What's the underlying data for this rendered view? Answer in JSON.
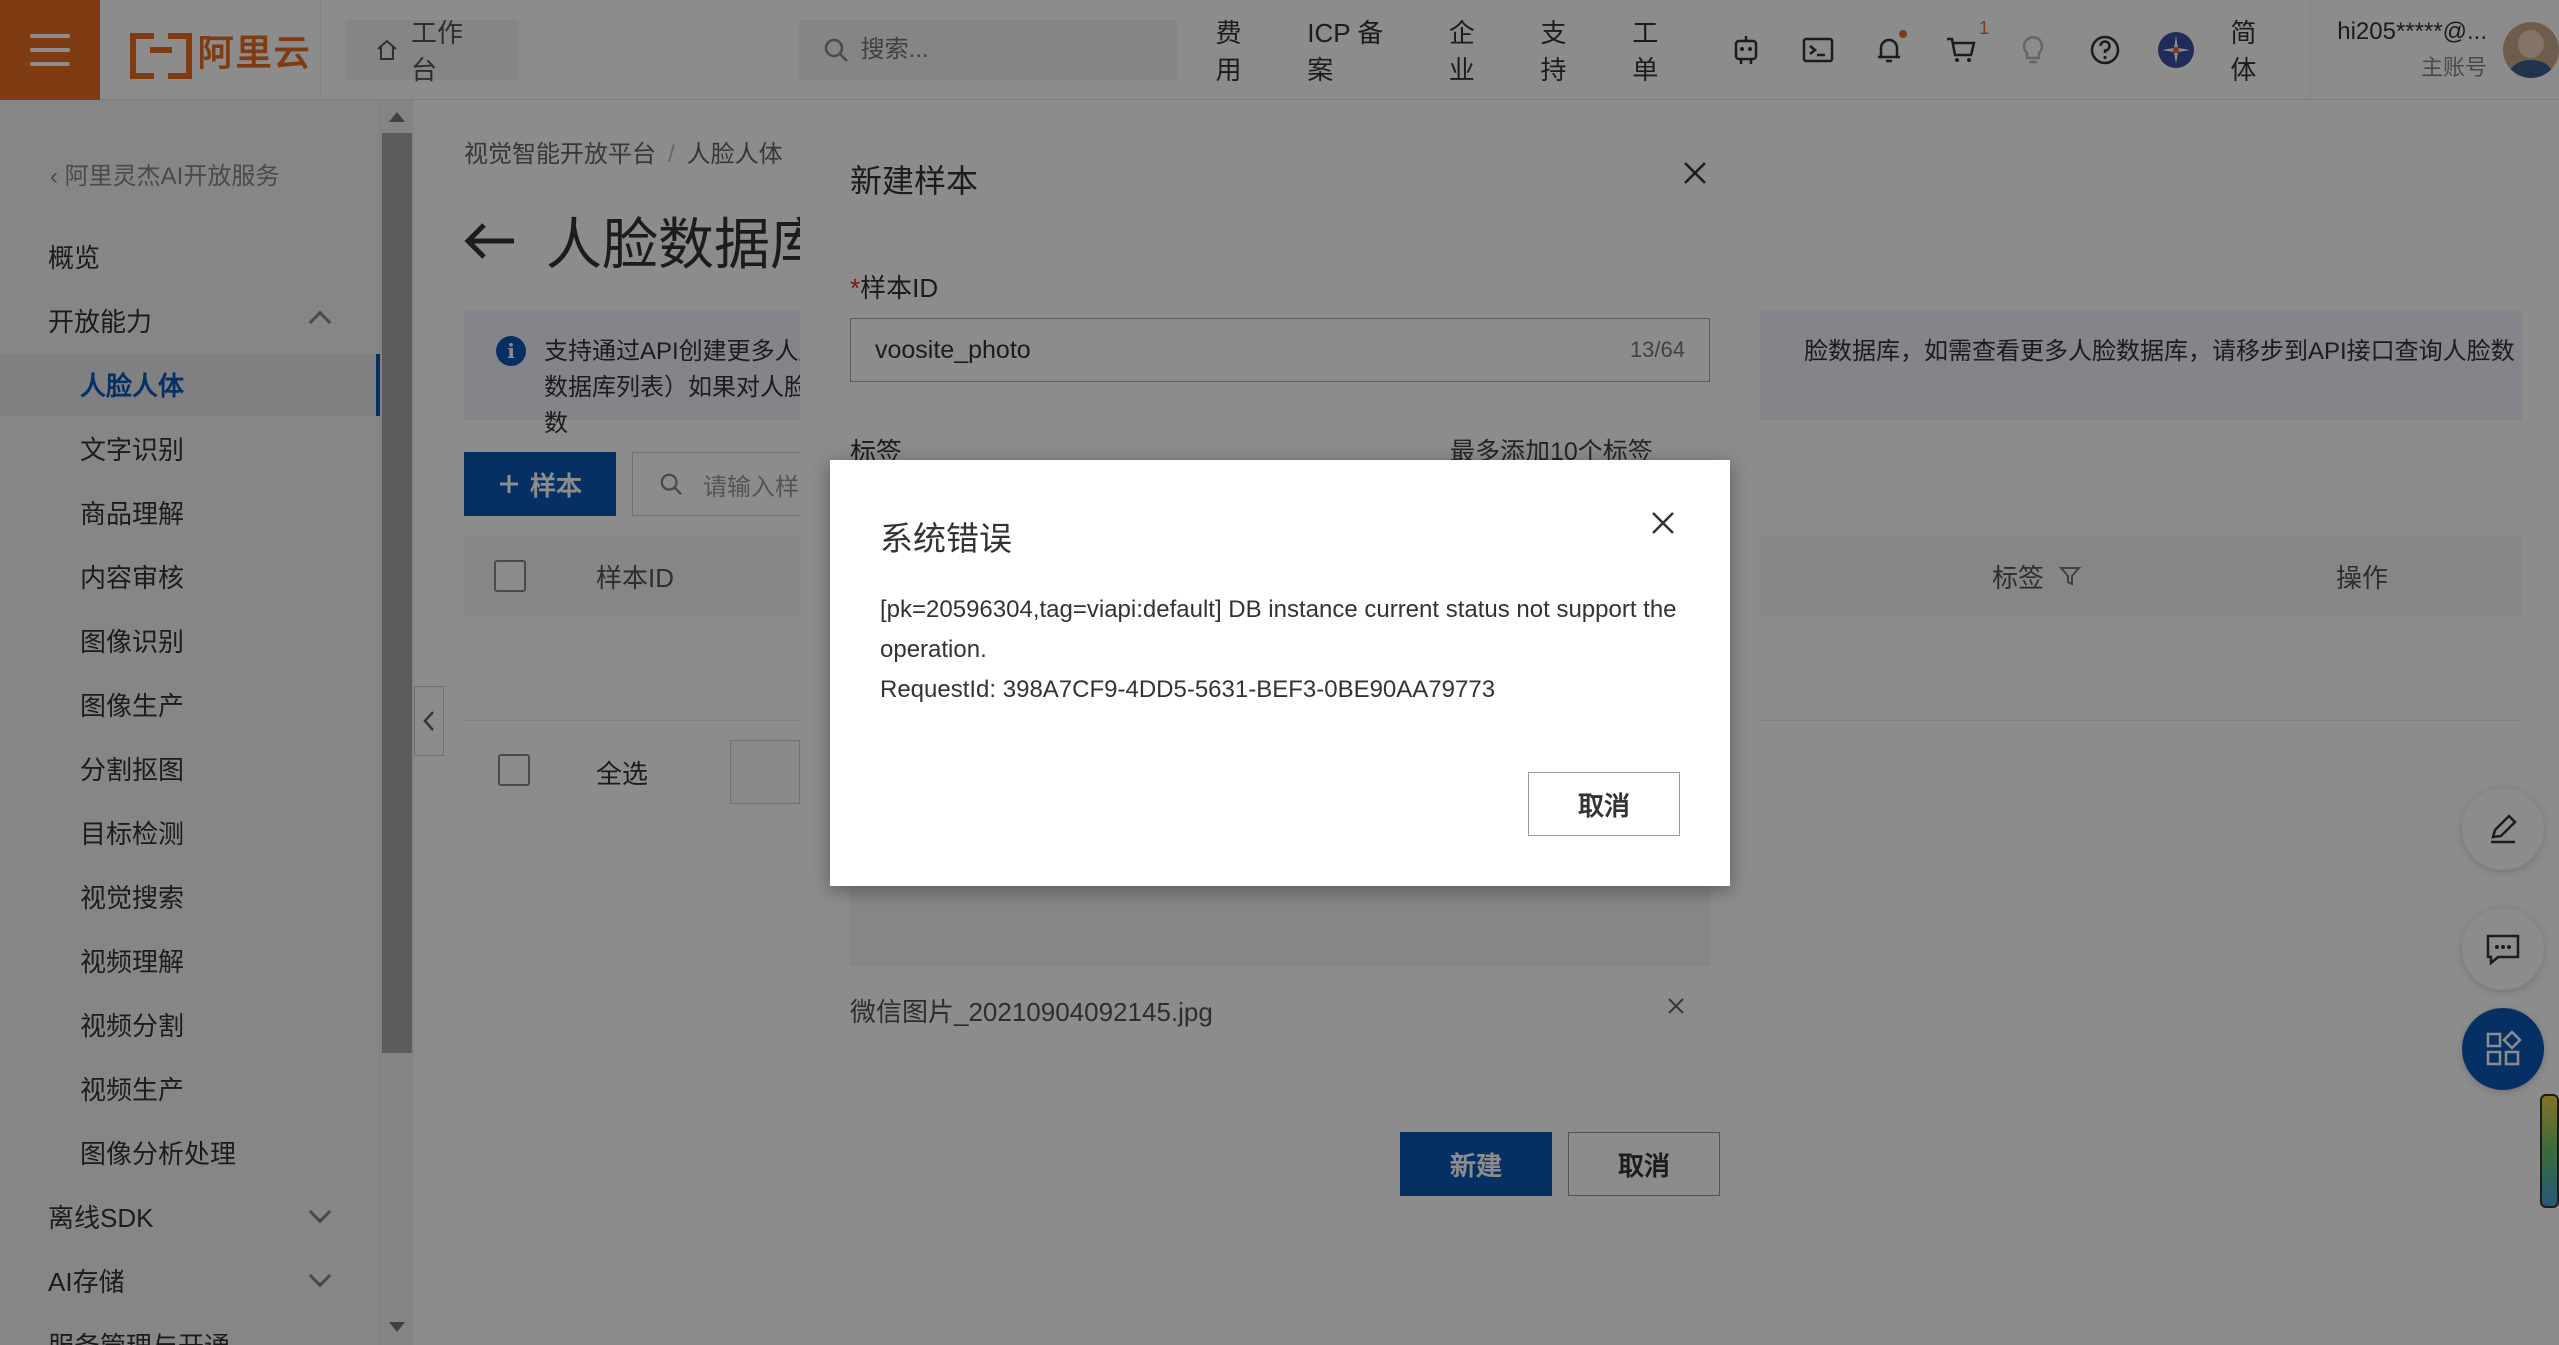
{
  "topbar": {
    "logo_text": "阿里云",
    "workbench": "工作台",
    "search_placeholder": "搜索...",
    "links": [
      "费用",
      "ICP 备案",
      "企业",
      "支持",
      "工单"
    ],
    "cart_count": "1",
    "language": "简体",
    "user_name": "hi205*****@...",
    "user_role": "主账号"
  },
  "sidebar": {
    "back_label": "阿里灵杰AI开放服务",
    "overview": "概览",
    "group_open": "开放能力",
    "items": [
      "人脸人体",
      "文字识别",
      "商品理解",
      "内容审核",
      "图像识别",
      "图像生产",
      "分割抠图",
      "目标检测",
      "视觉搜索",
      "视频理解",
      "视频分割",
      "视频生产",
      "图像分析处理"
    ],
    "group_sdk": "离线SDK",
    "group_storage": "AI存储",
    "group_service": "服务管理与开通"
  },
  "main": {
    "breadcrumb": [
      "视觉智能开放平台",
      "人脸人体"
    ],
    "title": "人脸数据库",
    "info_left": "支持通过API创建更多人脸数据库列表）如果对人脸数",
    "info_right": "脸数据库，如需查看更多人脸数据库，请移步到API接口查询人脸数",
    "add_button": "样本",
    "filter_placeholder": "请输入样",
    "columns": {
      "sample_id": "样本ID",
      "tags": "标签",
      "actions": "操作"
    },
    "select_all": "全选"
  },
  "new_sample_dialog": {
    "title": "新建样本",
    "sample_id_label": "样本ID",
    "sample_id_value": "voosite_photo",
    "sample_id_counter": "13/64",
    "tags_label": "标签",
    "tags_hint": "最多添加10个标签",
    "file_name": "微信图片_20210904092145.jpg",
    "create_button": "新建",
    "cancel_button": "取消"
  },
  "error_dialog": {
    "title": "系统错误",
    "message": "[pk=20596304,tag=viapi:default] DB instance current status not support the operation.",
    "request_id": "RequestId: 398A7CF9-4DD5-5631-BEF3-0BE90AA79773",
    "cancel_button": "取消"
  },
  "colors": {
    "brand": "#e76d21",
    "primary": "#0b58b7",
    "required": "#d9262c"
  }
}
